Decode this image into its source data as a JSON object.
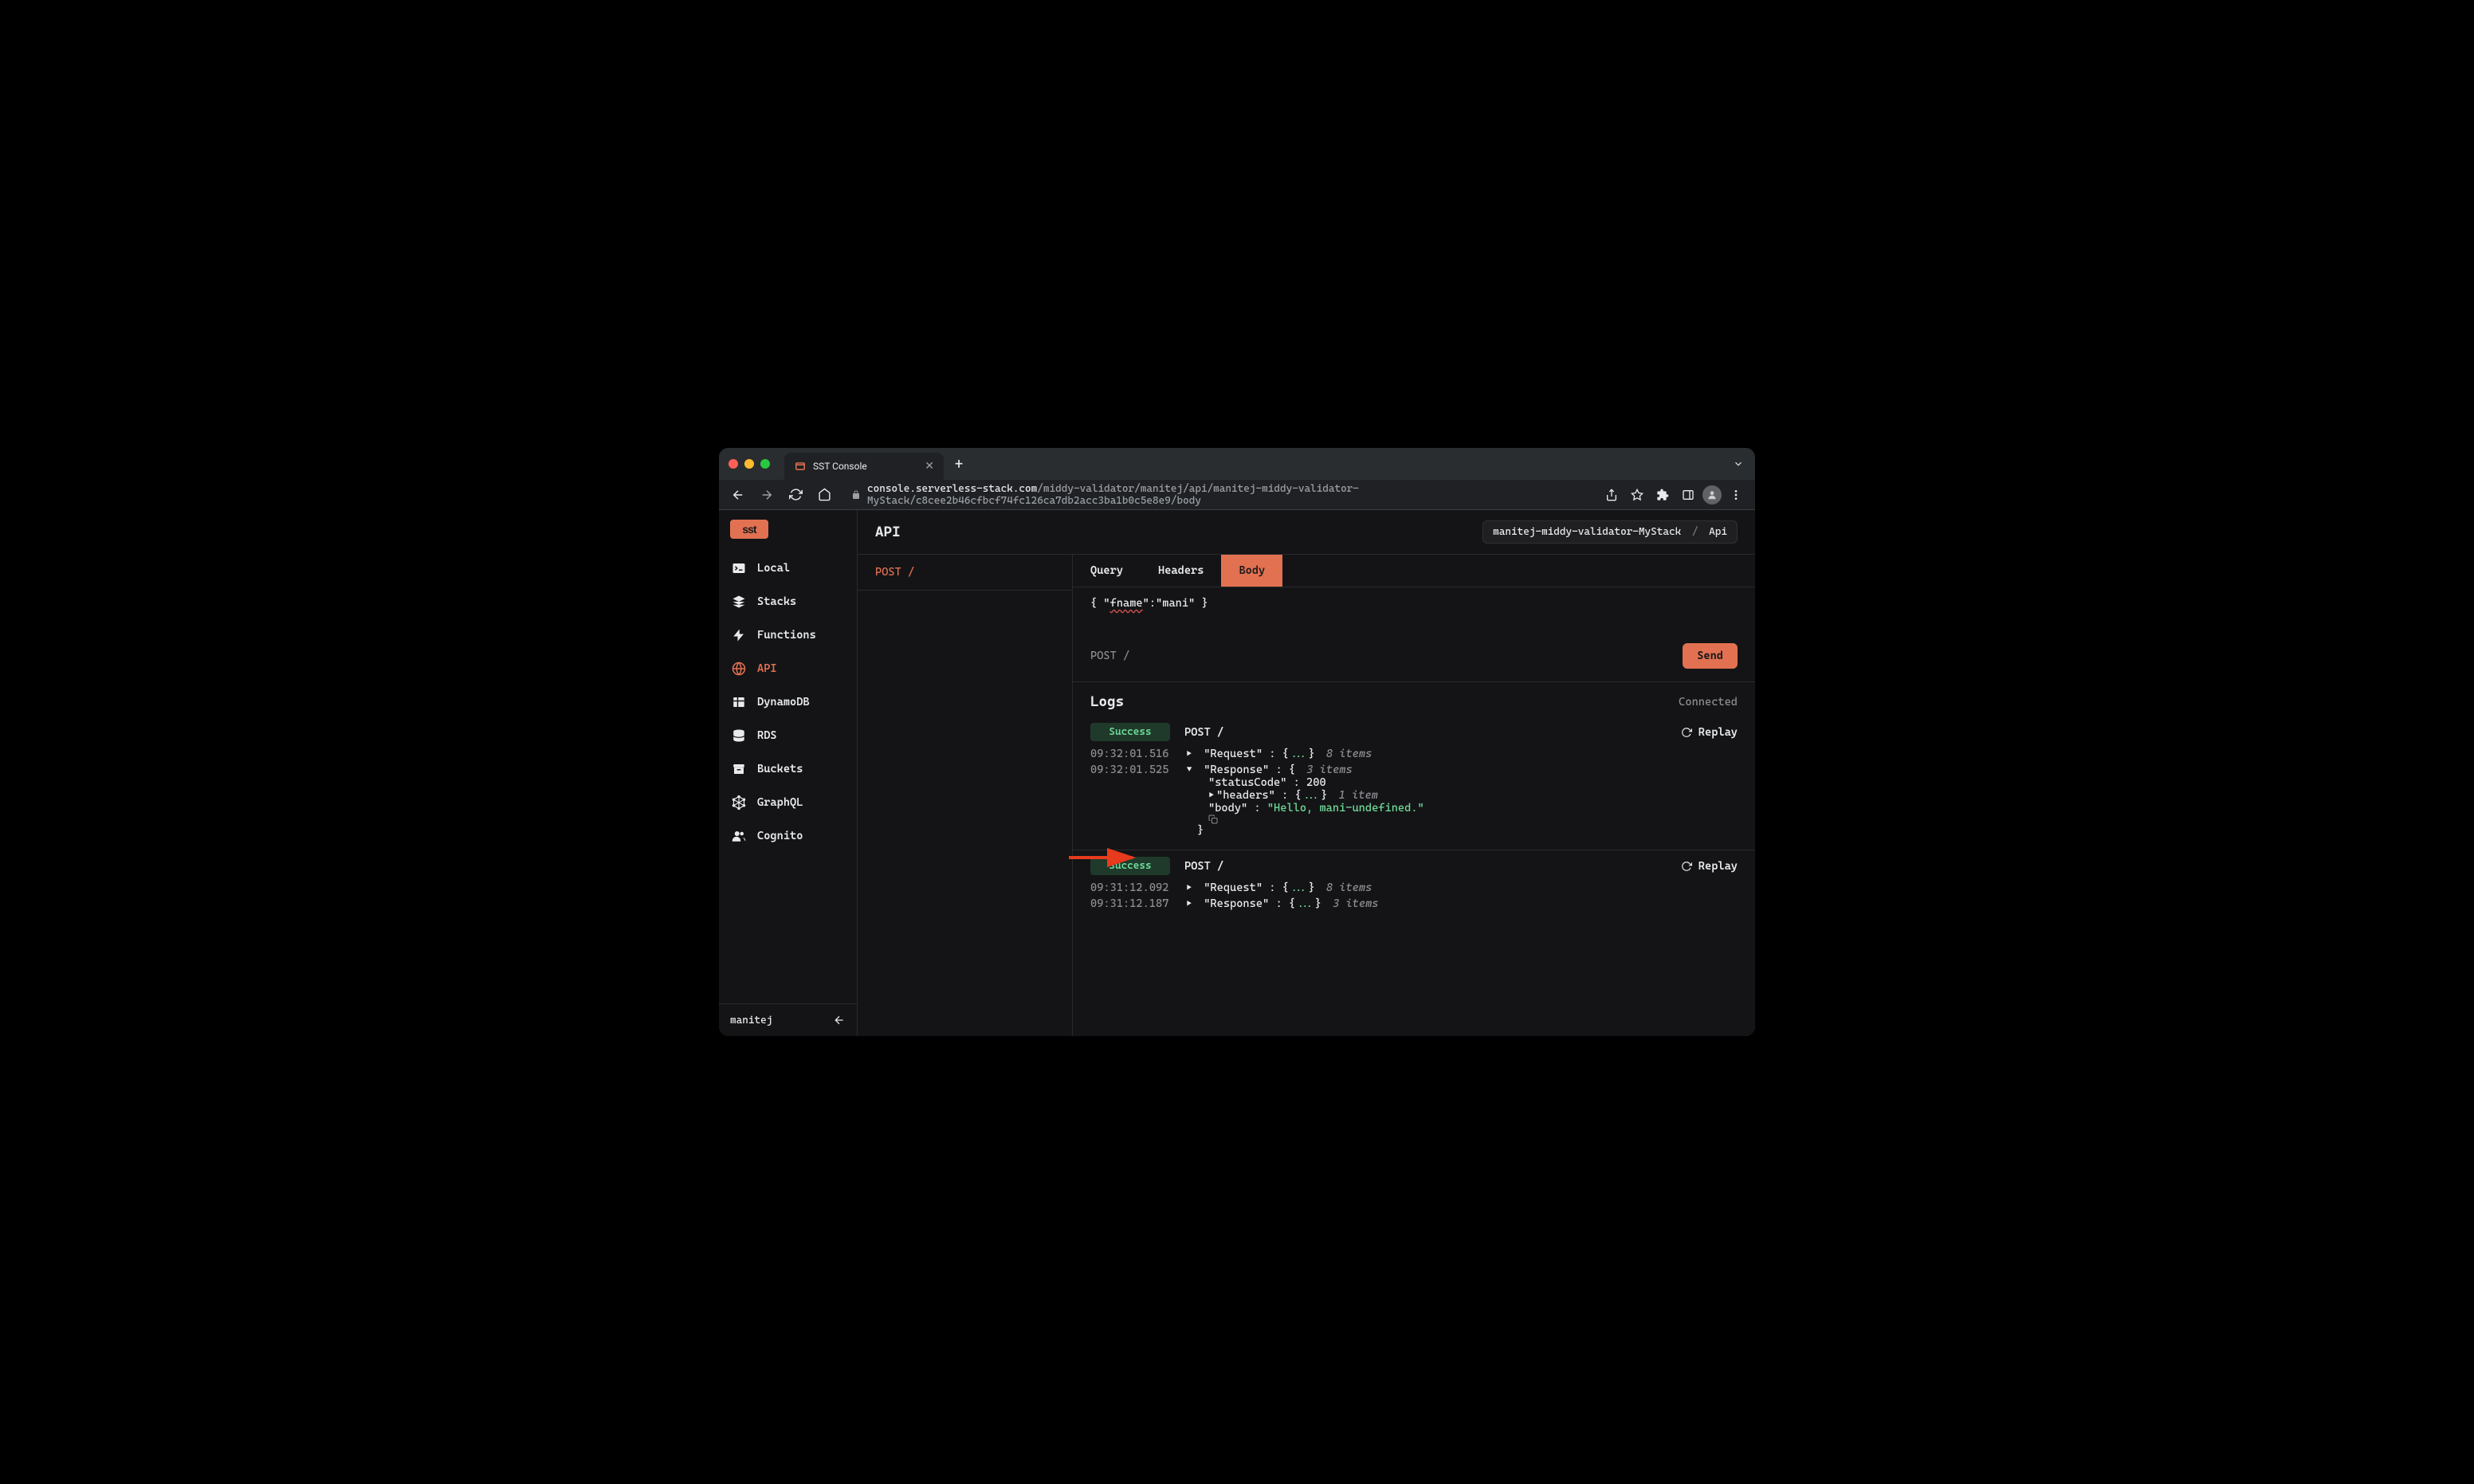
{
  "browser": {
    "tab_title": "SST Console",
    "url_domain": "console.serverless-stack.com",
    "url_path": "/middy-validator/manitej/api/manitej-middy-validator-MyStack/c8cee2b46cfbcf74fc126ca7db2acc3ba1b0c5e8e9/body"
  },
  "sidebar": {
    "logo": "sst",
    "items": [
      {
        "label": "Local",
        "icon": "terminal"
      },
      {
        "label": "Stacks",
        "icon": "layers"
      },
      {
        "label": "Functions",
        "icon": "bolt"
      },
      {
        "label": "API",
        "icon": "globe",
        "active": true
      },
      {
        "label": "DynamoDB",
        "icon": "table"
      },
      {
        "label": "RDS",
        "icon": "database"
      },
      {
        "label": "Buckets",
        "icon": "archive"
      },
      {
        "label": "GraphQL",
        "icon": "graphql"
      },
      {
        "label": "Cognito",
        "icon": "users"
      }
    ],
    "footer_user": "manitej"
  },
  "page": {
    "title": "API",
    "breadcrumb": {
      "stack": "manitej-middy-validator-MyStack",
      "resource": "Api"
    },
    "route": "POST /",
    "request_tabs": [
      "Query",
      "Headers",
      "Body"
    ],
    "active_tab": "Body",
    "body_content": "{ \"fname\":\"mani\" }",
    "send": {
      "method": "POST /",
      "button": "Send"
    }
  },
  "logs": {
    "title": "Logs",
    "status": "Connected",
    "replay_label": "Replay",
    "entries": [
      {
        "status": "Success",
        "method": "POST /",
        "lines": [
          {
            "ts": "09:32:01.516",
            "expanded": false,
            "label": "Request",
            "items": "8 items"
          },
          {
            "ts": "09:32:01.525",
            "expanded": true,
            "label": "Response",
            "items": "3 items",
            "children": {
              "statusCode": 200,
              "headers_items": "1 item",
              "body": "\"Hello, mani-undefined.\""
            }
          }
        ]
      },
      {
        "status": "Success",
        "method": "POST /",
        "lines": [
          {
            "ts": "09:31:12.092",
            "expanded": false,
            "label": "Request",
            "items": "8 items"
          },
          {
            "ts": "09:31:12.187",
            "expanded": false,
            "label": "Response",
            "items": "3 items"
          }
        ]
      }
    ]
  }
}
